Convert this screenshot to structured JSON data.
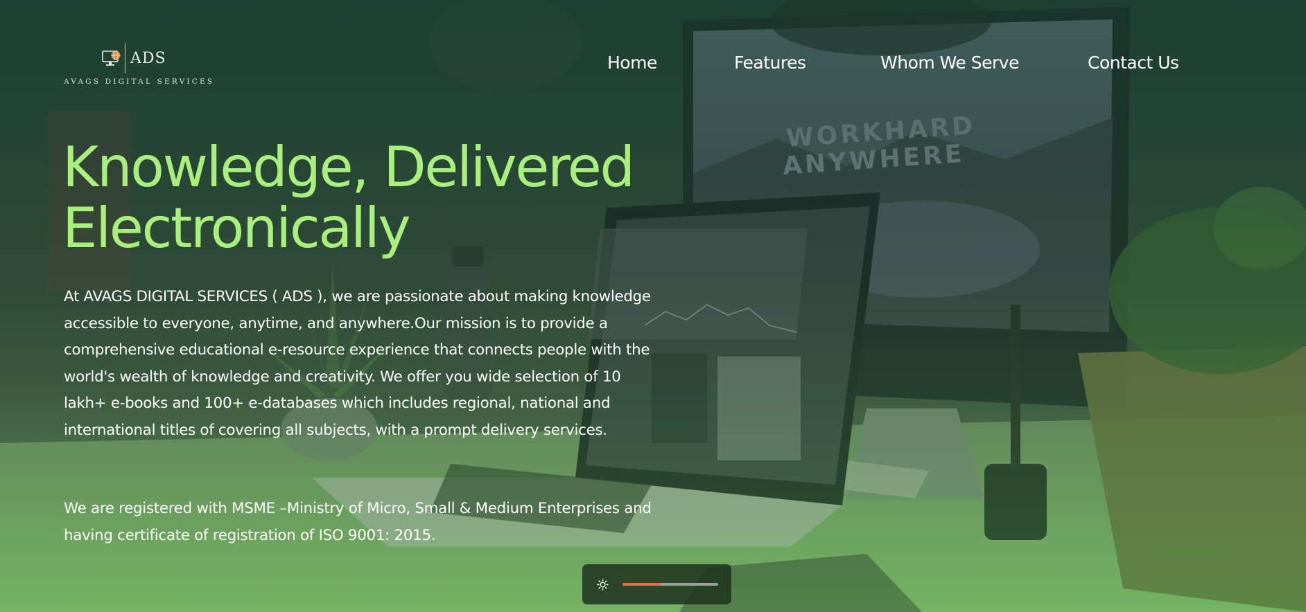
{
  "brand": {
    "logo_text": "ADS",
    "tagline": "AVAGS DIGITAL SERVICES",
    "icon": "monitor-globe-icon"
  },
  "nav": {
    "items": [
      {
        "label": "Home"
      },
      {
        "label": "Features"
      },
      {
        "label": "Whom We Serve"
      },
      {
        "label": "Contact Us"
      }
    ]
  },
  "hero": {
    "headline_line1": "Knowledge, Delivered",
    "headline_line2": "Electronically",
    "paragraph1": "At AVAGS DIGITAL SERVICES ( ADS ), we are passionate about making knowledge accessible to everyone, anytime, and anywhere.Our mission is to provide a comprehensive educational e-resource experience that connects people with the world's wealth of knowledge and creativity. We offer you wide selection of 10 lakh+ e-books and 100+ e-databases which includes regional, national and international titles of covering all subjects, with a prompt delivery services.",
    "paragraph2": "We are registered with MSME –Ministry of Micro, Small & Medium Enterprises and having certificate of registration of ISO 9001: 2015."
  },
  "brightness_control": {
    "icon": "sun-icon",
    "level": 0.4
  },
  "background_photo": {
    "monitor_text_line1": "WORKHARD",
    "monitor_text_line2": "ANYWHERE"
  },
  "colors": {
    "headline": "#a8f07a",
    "slider_fill": "#e2704a",
    "slider_track": "#9aa39a"
  }
}
